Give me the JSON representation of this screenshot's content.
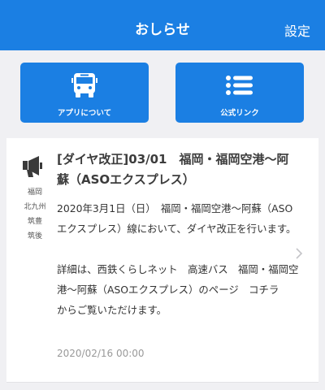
{
  "header": {
    "title": "おしらせ",
    "settings_label": "設定"
  },
  "tiles": [
    {
      "label": "アプリについて",
      "icon": "bus-icon"
    },
    {
      "label": "公式リンク",
      "icon": "list-icon"
    }
  ],
  "news": {
    "icon": "megaphone-icon",
    "regions": [
      "福岡",
      "北九州",
      "筑豊",
      "筑後"
    ],
    "title": "[ダイヤ改正]03/01　福岡・福岡空港〜阿蘇（ASOエクスプレス）",
    "body1": "2020年3月1日（日）　福岡・福岡空港〜阿蘇（ASOエクスプレス）線において、ダイヤ改正を行います。",
    "body2": "詳細は、西鉄くらしネット　高速バス　福岡・福岡空港〜阿蘇（ASOエクスプレス）のページ　コチラ　からご覧いただけます。",
    "date": "2020/02/16 00:00"
  },
  "colors": {
    "accent": "#1b7fe3",
    "background": "#f0f0f3"
  }
}
